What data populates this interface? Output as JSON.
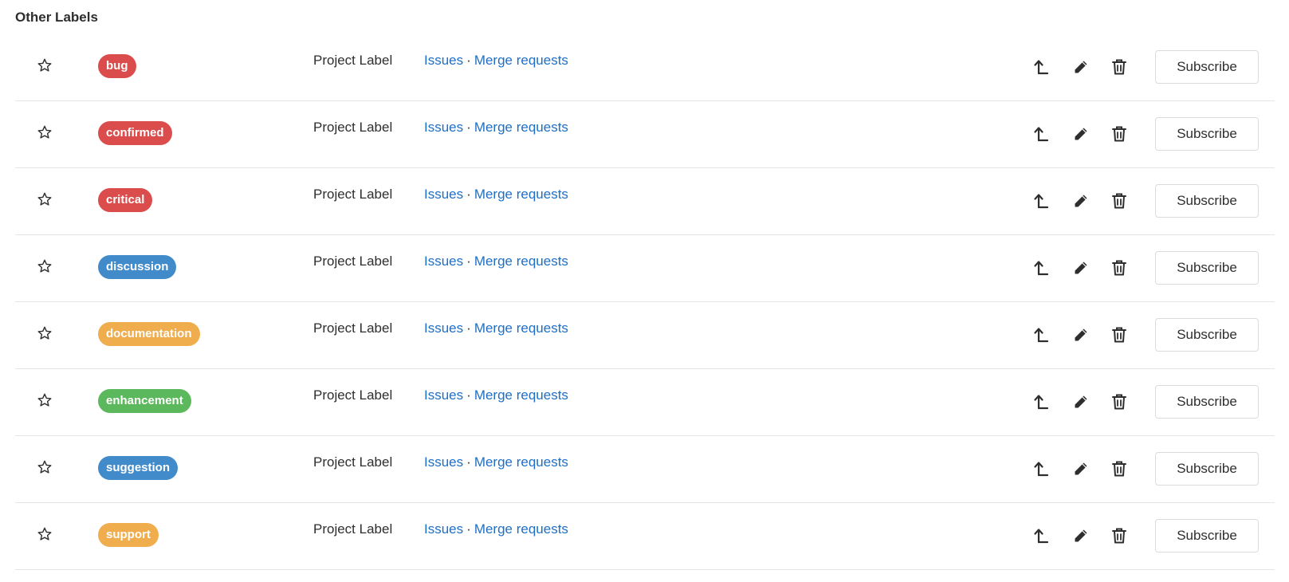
{
  "section": {
    "title": "Other Labels"
  },
  "labels": [
    {
      "name": "bug",
      "color": "#db4c4c",
      "type": "Project Label",
      "issues": "Issues",
      "separator": "·",
      "merge_requests": "Merge requests",
      "subscribe": "Subscribe"
    },
    {
      "name": "confirmed",
      "color": "#db4c4c",
      "type": "Project Label",
      "issues": "Issues",
      "separator": "·",
      "merge_requests": "Merge requests",
      "subscribe": "Subscribe"
    },
    {
      "name": "critical",
      "color": "#db4c4c",
      "type": "Project Label",
      "issues": "Issues",
      "separator": "·",
      "merge_requests": "Merge requests",
      "subscribe": "Subscribe"
    },
    {
      "name": "discussion",
      "color": "#428bca",
      "type": "Project Label",
      "issues": "Issues",
      "separator": "·",
      "merge_requests": "Merge requests",
      "subscribe": "Subscribe"
    },
    {
      "name": "documentation",
      "color": "#f0ad4e",
      "type": "Project Label",
      "issues": "Issues",
      "separator": "·",
      "merge_requests": "Merge requests",
      "subscribe": "Subscribe"
    },
    {
      "name": "enhancement",
      "color": "#5cb85c",
      "type": "Project Label",
      "issues": "Issues",
      "separator": "·",
      "merge_requests": "Merge requests",
      "subscribe": "Subscribe"
    },
    {
      "name": "suggestion",
      "color": "#428bca",
      "type": "Project Label",
      "issues": "Issues",
      "separator": "·",
      "merge_requests": "Merge requests",
      "subscribe": "Subscribe"
    },
    {
      "name": "support",
      "color": "#f0ad4e",
      "type": "Project Label",
      "issues": "Issues",
      "separator": "·",
      "merge_requests": "Merge requests",
      "subscribe": "Subscribe"
    }
  ],
  "icons": {
    "star": "star-outline-icon",
    "promote": "level-up-icon",
    "edit": "pencil-icon",
    "delete": "trash-icon"
  },
  "colors": {
    "link": "#1f6fc5",
    "text": "#2e2e2e",
    "divider": "#e5e5e5"
  }
}
